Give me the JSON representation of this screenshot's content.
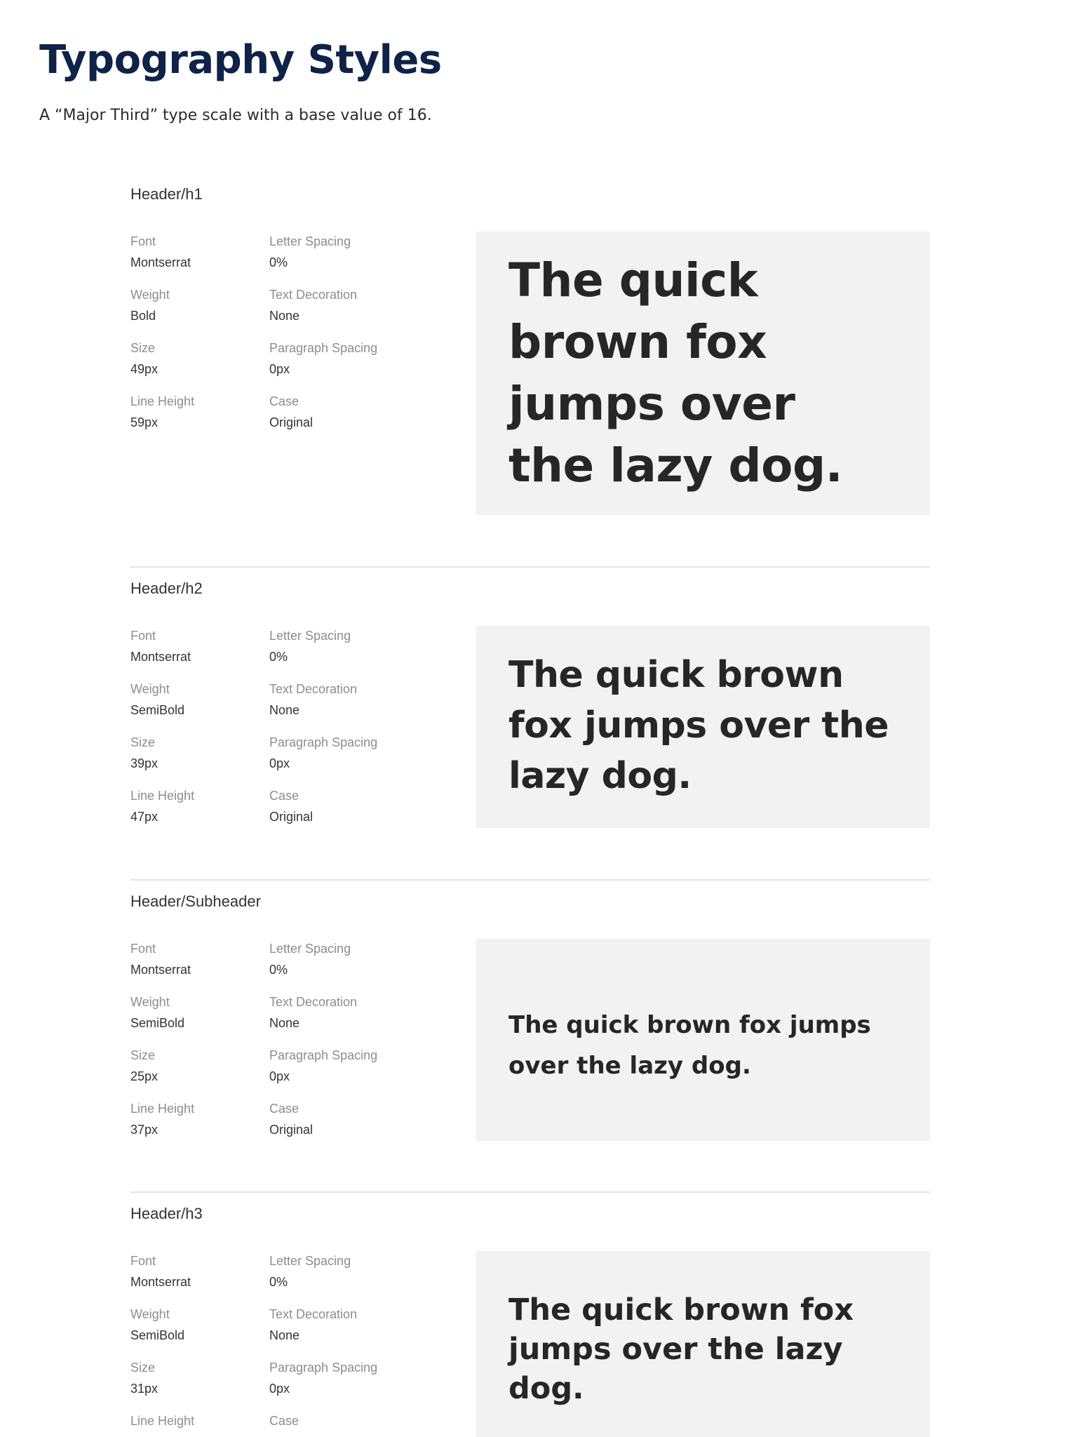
{
  "page": {
    "title": "Typography Styles",
    "subtitle": "A  “Major Third” type scale with a base value of 16."
  },
  "styles": [
    {
      "name": "Header/h1",
      "props": {
        "font": {
          "label": "Font",
          "value": "Montserrat"
        },
        "weight": {
          "label": "Weight",
          "value": "Bold"
        },
        "size": {
          "label": "Size",
          "value": "49px"
        },
        "line_height": {
          "label": "Line Height",
          "value": "59px"
        },
        "letter_spacing": {
          "label": "Letter Spacing",
          "value": "0%"
        },
        "text_decoration": {
          "label": "Text Decoration",
          "value": "None"
        },
        "paragraph_spacing": {
          "label": "Paragraph Spacing",
          "value": "0px"
        },
        "case": {
          "label": "Case",
          "value": "Original"
        }
      },
      "sample": "The quick brown fox jumps over the lazy dog."
    },
    {
      "name": "Header/h2",
      "props": {
        "font": {
          "label": "Font",
          "value": "Montserrat"
        },
        "weight": {
          "label": "Weight",
          "value": "SemiBold"
        },
        "size": {
          "label": "Size",
          "value": "39px"
        },
        "line_height": {
          "label": "Line Height",
          "value": "47px"
        },
        "letter_spacing": {
          "label": "Letter Spacing",
          "value": "0%"
        },
        "text_decoration": {
          "label": "Text Decoration",
          "value": "None"
        },
        "paragraph_spacing": {
          "label": "Paragraph Spacing",
          "value": "0px"
        },
        "case": {
          "label": "Case",
          "value": "Original"
        }
      },
      "sample": "The quick brown fox jumps over the lazy dog."
    },
    {
      "name": "Header/Subheader",
      "props": {
        "font": {
          "label": "Font",
          "value": "Montserrat"
        },
        "weight": {
          "label": "Weight",
          "value": "SemiBold"
        },
        "size": {
          "label": "Size",
          "value": "25px"
        },
        "line_height": {
          "label": "Line Height",
          "value": "37px"
        },
        "letter_spacing": {
          "label": "Letter Spacing",
          "value": "0%"
        },
        "text_decoration": {
          "label": "Text Decoration",
          "value": "None"
        },
        "paragraph_spacing": {
          "label": "Paragraph Spacing",
          "value": "0px"
        },
        "case": {
          "label": "Case",
          "value": "Original"
        }
      },
      "sample": "The quick brown fox jumps over the lazy dog."
    },
    {
      "name": "Header/h3",
      "props": {
        "font": {
          "label": "Font",
          "value": "Montserrat"
        },
        "weight": {
          "label": "Weight",
          "value": "SemiBold"
        },
        "size": {
          "label": "Size",
          "value": "31px"
        },
        "line_height": {
          "label": "Line Height",
          "value": ""
        },
        "letter_spacing": {
          "label": "Letter Spacing",
          "value": "0%"
        },
        "text_decoration": {
          "label": "Text Decoration",
          "value": "None"
        },
        "paragraph_spacing": {
          "label": "Paragraph Spacing",
          "value": "0px"
        },
        "case": {
          "label": "Case",
          "value": ""
        }
      },
      "sample": "The quick brown fox jumps over the lazy dog."
    }
  ]
}
